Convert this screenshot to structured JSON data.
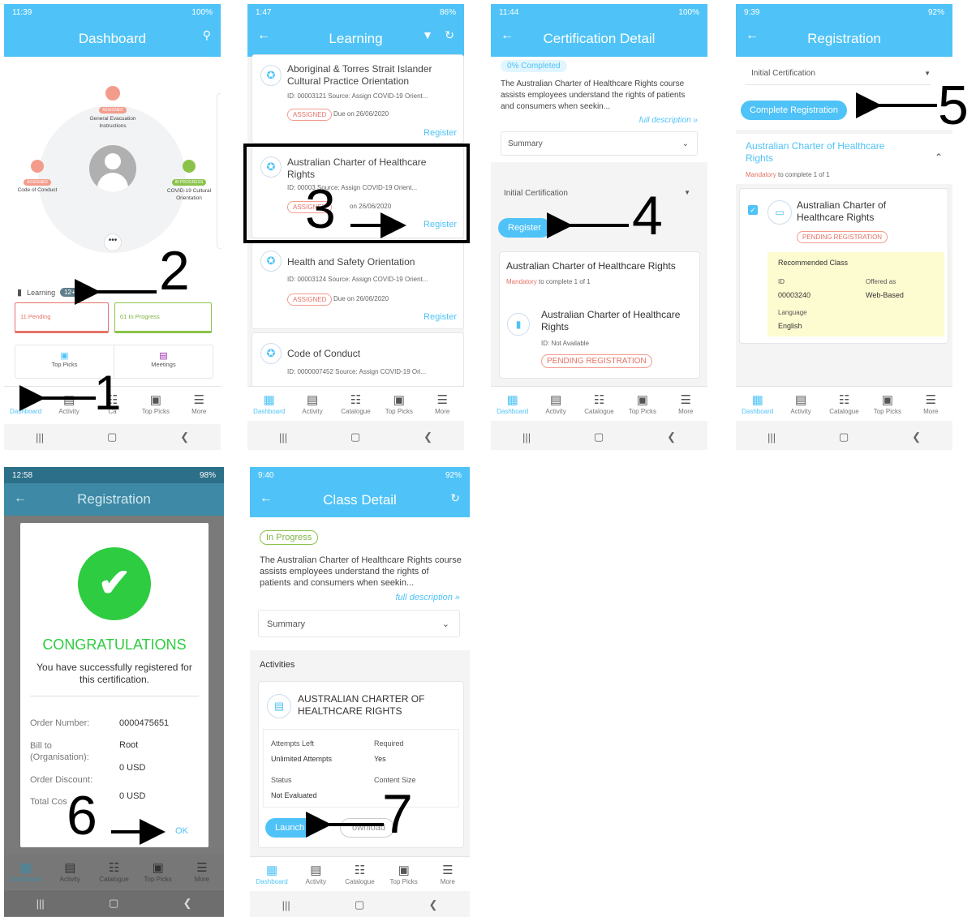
{
  "s1": {
    "status_time": "11:39",
    "status_right": "100%",
    "title": "Dashboard",
    "circle": {
      "top": "General Evacuation Instructions",
      "left": "Code of Conduct",
      "right": "COVID-19 Cultural Orientation",
      "top_badge": "ASSIGNED",
      "left_badge": "ASSIGNED",
      "right_badge": "IN PROGRESS"
    },
    "learning_label": "Learning",
    "learning_count": "12+",
    "pending": "11  Pending",
    "inprogress": "01  In Progress",
    "top_picks": "Top Picks",
    "meetings": "Meetings"
  },
  "s2": {
    "status_time": "1:47",
    "status_right": "86%",
    "title": "Learning",
    "items": [
      {
        "title": "Aboriginal & Torres Strait Islander Cultural Practice Orientation",
        "meta": "ID: 00003121   Source: Assign COVID-19 Orient...",
        "badge": "ASSIGNED",
        "due": "Due on 26/06/2020",
        "action": "Register"
      },
      {
        "title": "Australian Charter of Healthcare Rights",
        "meta": "ID: 00003   Source: Assign COVID-19 Orient...",
        "badge": "ASSIGNED",
        "due": "on 26/06/2020",
        "action": "Register"
      },
      {
        "title": "Health and Safety Orientation",
        "meta": "ID: 00003124   Source: Assign COVID-19 Orient...",
        "badge": "ASSIGNED",
        "due": "Due on 26/06/2020",
        "action": "Register"
      },
      {
        "title": "Code of Conduct",
        "meta": "ID: 0000007452   Source: Assign COVID-19 Ori...",
        "badge": "",
        "due": "",
        "action": ""
      }
    ]
  },
  "s3": {
    "status_time": "11:44",
    "status_right": "100%",
    "title": "Certification Detail",
    "completed": "0% Completed",
    "desc": "The Australian Charter of Healthcare Rights course assists employees understand the rights of patients and consumers when seekin...",
    "full_desc": "full description »",
    "summary": "Summary",
    "initial_cert": "Initial Certification",
    "register": "Register",
    "card_title": "Australian Charter of Healthcare Rights",
    "mandatory": "Mandatory",
    "mandatory_rest": "to complete 1 of 1",
    "item_title": "Australian Charter of Healthcare Rights",
    "item_id": "ID: Not Available",
    "pending": "PENDING REGISTRATION"
  },
  "s4": {
    "status_time": "9:39",
    "status_right": "92%",
    "title": "Registration",
    "initial_cert": "Initial Certification",
    "complete_btn": "Complete Registration",
    "section_title": "Australian Charter of Healthcare Rights",
    "mandatory": "Mandatory",
    "mandatory_rest": "to complete 1 of 1",
    "item_title": "Australian Charter of Healthcare Rights",
    "pending": "PENDING REGISTRATION",
    "rec_class": "Recommended Class",
    "id_label": "ID",
    "id_value": "00003240",
    "offered_label": "Offered as",
    "offered_value": "Web-Based",
    "lang_label": "Language",
    "lang_value": "English"
  },
  "s5": {
    "status_time": "12:58",
    "status_right": "98%",
    "title": "Registration",
    "congrats": "CONGRATULATIONS",
    "message": "You have successfully registered for this certification.",
    "order_label": "Order Number:",
    "order_value": "0000475651",
    "bill_label": "Bill to (Organisation):",
    "bill_value": "Root",
    "usd1": "0 USD",
    "discount_label": "Order Discount:",
    "total_label": "Total Cos",
    "usd2": "0 USD",
    "ok": "OK"
  },
  "s6": {
    "status_time": "9:40",
    "status_right": "92%",
    "title": "Class Detail",
    "in_progress": "In Progress",
    "desc": "The Australian Charter of Healthcare Rights course assists employees understand the rights of patients and consumers when seekin...",
    "full_desc": "full description »",
    "summary": "Summary",
    "activities": "Activities",
    "act_title": "AUSTRALIAN CHARTER OF HEALTHCARE RIGHTS",
    "attempts_label": "Attempts Left",
    "attempts_value": "Unlimited Attempts",
    "required_label": "Required",
    "required_value": "Yes",
    "status_label": "Status",
    "status_value": "Not Evaluated",
    "size_label": "Content Size",
    "launch": "Launch",
    "download": "ownload"
  },
  "nav": [
    "Dashboard",
    "Activity",
    "Catalogue",
    "Top Picks",
    "More"
  ],
  "nav_s1": [
    "Dashboard",
    "Activity",
    "Ca",
    "Top Picks",
    "More"
  ],
  "labels": [
    "1",
    "2",
    "3",
    "4",
    "5",
    "6",
    "7"
  ],
  "colors": {
    "accent": "#4fc3f7",
    "success": "#2ecc40",
    "pending": "#e57368"
  }
}
